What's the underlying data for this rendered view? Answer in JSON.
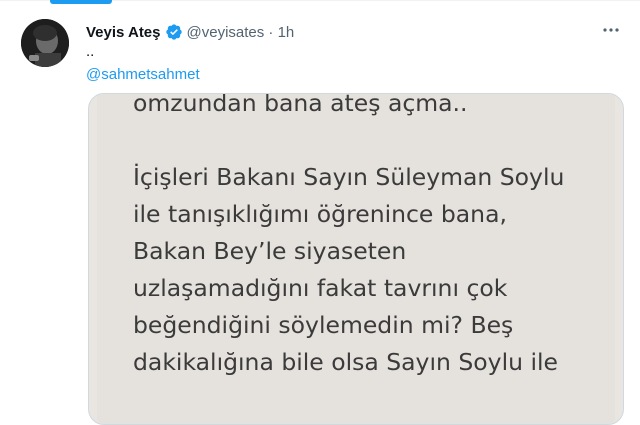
{
  "tweet": {
    "author_name": "Veyis Ateş",
    "handle_time": "@veyisates · 1h",
    "text": "..",
    "mention": "@sahmetsahmet"
  },
  "media": {
    "lines_top": [
      "omzundan bana ateş açma.."
    ],
    "lines_main": [
      "İçişleri Bakanı Sayın Süleyman Soylu",
      "ile tanışıklığımı öğrenince bana,",
      "Bakan Bey’le siyaseten",
      "uzlaşamadığını fakat tavrını çok",
      "beğendiğini söylemedin mi? Beş",
      "dakikalığına bile olsa Sayın Soylu ile"
    ]
  },
  "icons": {
    "verified": "verified-badge-icon",
    "more": "more-options-icon"
  },
  "colors": {
    "accent": "#1d9bf0",
    "text": "#0f1419",
    "secondary": "#536471",
    "image_bg": "#e5e1dd"
  }
}
